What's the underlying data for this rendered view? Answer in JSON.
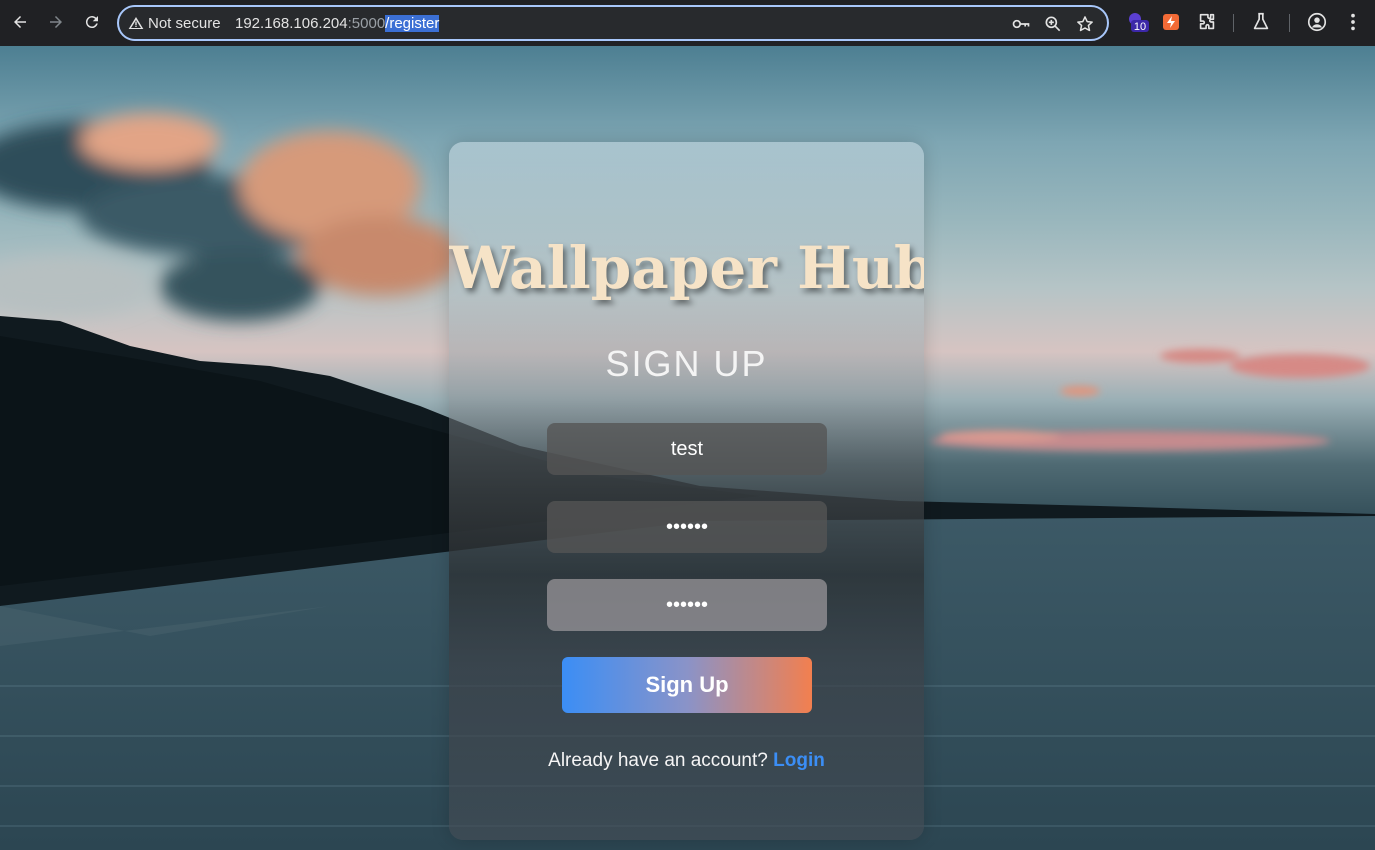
{
  "browser": {
    "security_label": "Not secure",
    "url_host": "192.168.106.204",
    "url_port": ":5000",
    "url_path": "/register",
    "extension_badge": "10",
    "icons": [
      "back-arrow-icon",
      "forward-arrow-icon",
      "reload-icon",
      "warning-icon",
      "key-icon",
      "zoom-icon",
      "star-icon",
      "extension-icon",
      "flask-icon",
      "profile-icon",
      "menu-icon"
    ]
  },
  "page": {
    "app_title": "Wallpaper Hub",
    "form_heading": "SIGN UP",
    "username_value": "test",
    "password_value": "••••••",
    "confirm_password_value": "••••••",
    "submit_label": "Sign Up",
    "login_prompt": "Already have an account?",
    "login_link": "Login"
  },
  "colors": {
    "accent_blue": "#3b8ef5",
    "accent_orange": "#f27f4f",
    "title_color": "#f6e3c7"
  }
}
